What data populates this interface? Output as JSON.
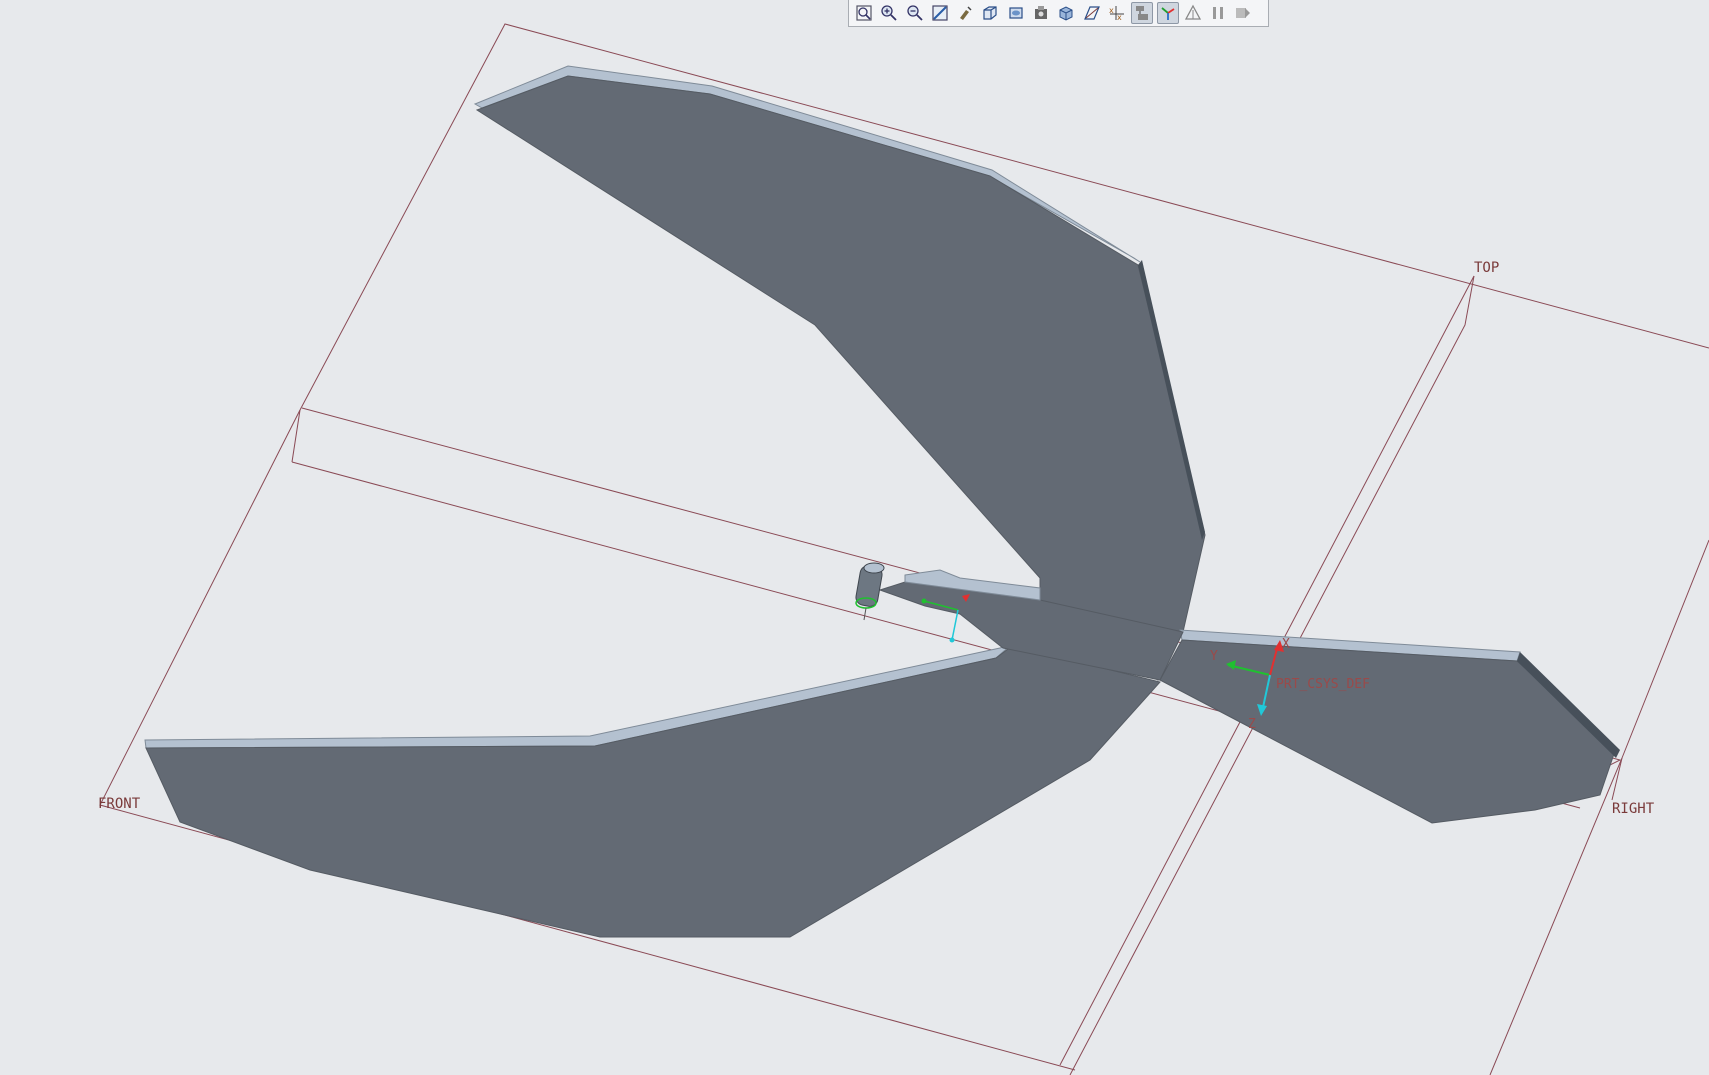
{
  "toolbar": {
    "buttons": [
      {
        "icon": "refit-icon",
        "active": false
      },
      {
        "icon": "zoom-in-icon",
        "active": false
      },
      {
        "icon": "zoom-out-icon",
        "active": false
      },
      {
        "icon": "repaint-icon",
        "active": false
      },
      {
        "icon": "pan-zoom-icon",
        "active": false
      },
      {
        "icon": "saved-orientations-icon",
        "active": false
      },
      {
        "icon": "view-manager-icon",
        "active": false
      },
      {
        "icon": "display-style-icon",
        "active": false
      },
      {
        "icon": "shade-icon",
        "active": false
      },
      {
        "icon": "datum-display-filter-icon",
        "active": false
      },
      {
        "icon": "datum-points-icon",
        "active": false
      },
      {
        "icon": "csys-display-icon",
        "active": true
      },
      {
        "icon": "spin-center-icon",
        "active": true
      },
      {
        "icon": "annotation-display-icon",
        "active": false
      },
      {
        "icon": "pause-icon",
        "active": false
      },
      {
        "icon": "end-icon",
        "active": false
      }
    ]
  },
  "model": {
    "datum_planes": {
      "top": "TOP",
      "front": "FRONT",
      "right": "RIGHT"
    },
    "csys": {
      "name": "PRT_CSYS_DEF",
      "axis_x": "X",
      "axis_y": "Y",
      "axis_z": "Z"
    },
    "colors": {
      "background": "#e7e9ec",
      "part_face": "#636a74",
      "part_edge": "#b4c1d0",
      "datum_plane": "#8a4a55",
      "csys_x": "#e23030",
      "csys_y": "#20c030",
      "csys_z": "#20c8d8"
    }
  }
}
